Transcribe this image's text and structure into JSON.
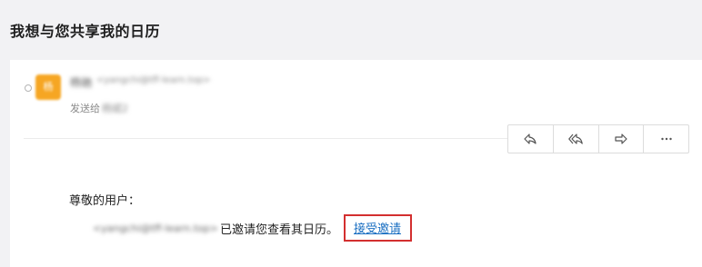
{
  "page": {
    "title": "我想与您共享我的日历"
  },
  "sender": {
    "avatar_text": "杨",
    "name": "杨驰",
    "email": "<yangchi@tff-learn.top>"
  },
  "recipients": {
    "prefix": "发送给",
    "name": "杨斌2"
  },
  "toolbar": {
    "icons": [
      "reply-icon",
      "reply-all-icon",
      "forward-icon",
      "more-icon"
    ]
  },
  "message": {
    "greeting": "尊敬的用户：",
    "inviter_email": "<yangchi@tff-learn.top>",
    "invite_text": "已邀请您查看其日历。",
    "accept_link": "接受邀请"
  },
  "colors": {
    "avatar": "#f6a623",
    "link": "#1a6fc2",
    "highlight_box": "#d32f2f",
    "background": "#f2f2f4"
  }
}
